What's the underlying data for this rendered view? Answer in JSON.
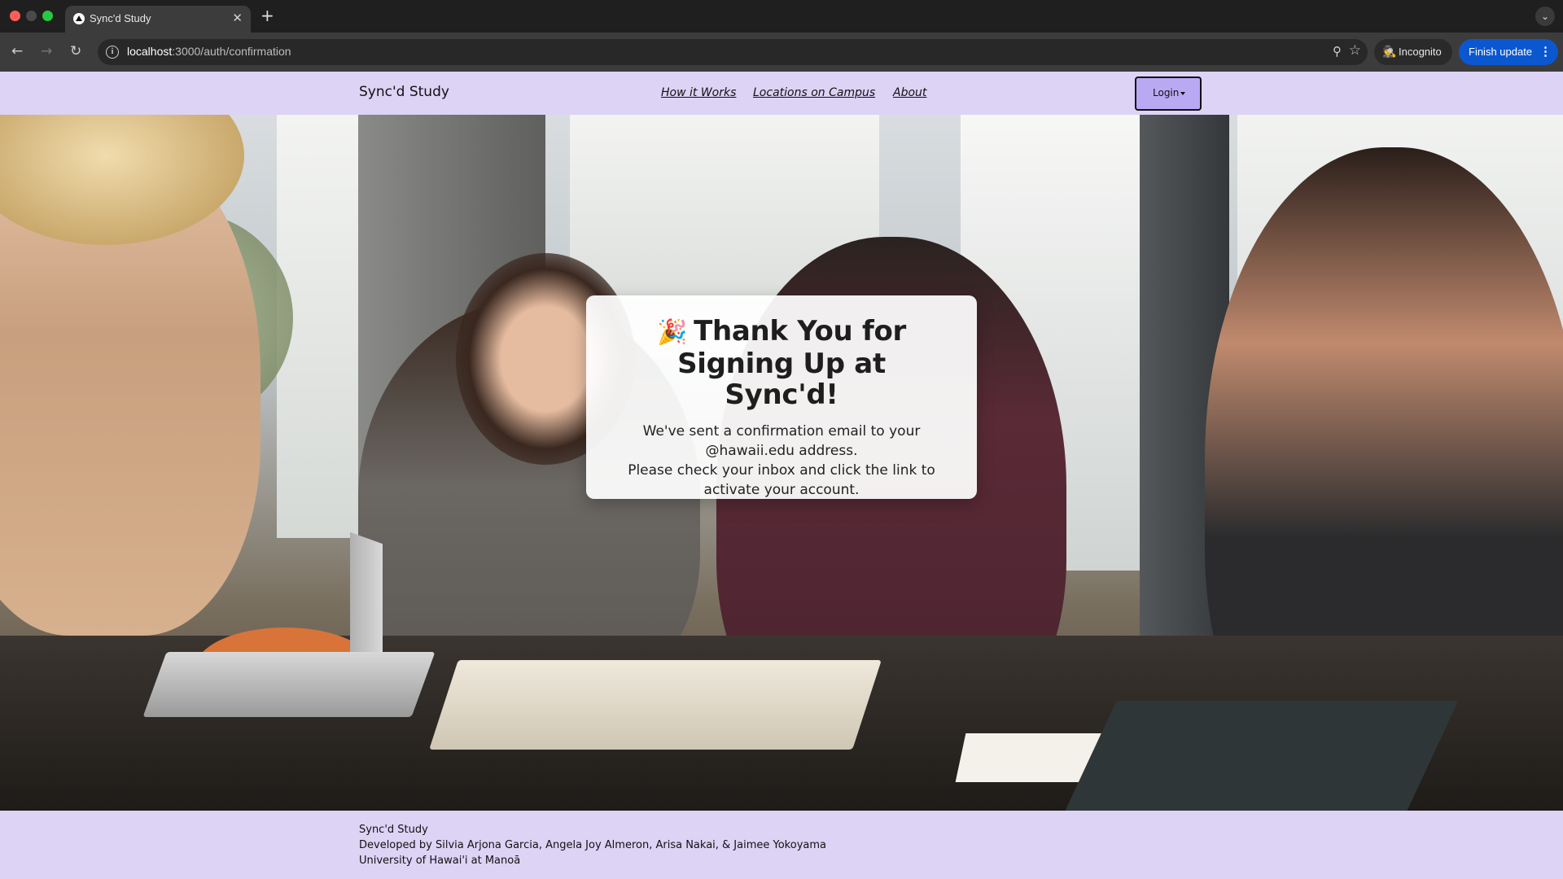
{
  "browser": {
    "tab_title": "Sync'd Study",
    "tab_close_glyph": "✕",
    "new_tab_glyph": "+",
    "tab_menu_glyph": "⌄",
    "url_host": "localhost",
    "url_rest": ":3000/auth/confirmation",
    "incognito_label": "Incognito",
    "finish_update_label": "Finish update",
    "icons": {
      "back": "back-arrow-icon",
      "forward": "forward-arrow-icon",
      "reload": "reload-icon",
      "zoom": "zoom-icon",
      "bookmark": "star-icon",
      "incognito": "incognito-icon",
      "menu": "more-vert-icon"
    }
  },
  "nav": {
    "brand": "Sync'd Study",
    "links": [
      {
        "label": "How it Works"
      },
      {
        "label": "Locations on Campus"
      },
      {
        "label": "About"
      }
    ],
    "login_label": "Login"
  },
  "card": {
    "emoji": "🎉",
    "title": "Thank You for Signing Up at Sync'd!",
    "line1": "We've sent a confirmation email to your @hawaii.edu address.",
    "line2": "Please check your inbox and click the link to activate your account."
  },
  "footer": {
    "line1": "Sync'd Study",
    "line2": "Developed by Silvia Arjona Garcia, Angela Joy Almeron, Arisa Nakai, & Jaimee Yokoyama",
    "line3": "University of Hawai'i at Manoā"
  },
  "colors": {
    "nav_bg": "#dcd3f5",
    "login_bg": "#b9a9f3",
    "finish_update_bg": "#0b57d0"
  }
}
